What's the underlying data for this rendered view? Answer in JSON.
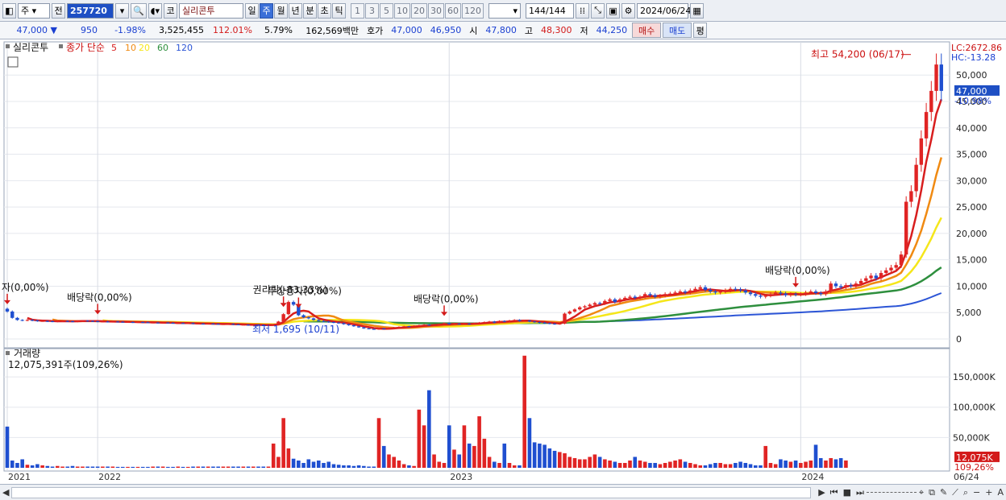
{
  "toolbar": {
    "market": "주",
    "prev": "전",
    "code": "257720",
    "name": "실리콘투",
    "periods": [
      "일",
      "주",
      "월",
      "년",
      "분",
      "초",
      "틱"
    ],
    "selected_period": "주",
    "nums": [
      "1",
      "3",
      "5",
      "10",
      "20",
      "30",
      "60",
      "120"
    ],
    "count": "144",
    "total": "/144",
    "date": "2024/06/24",
    "co": "코"
  },
  "quote": {
    "price": "47,000",
    "arrow": "▼",
    "change": "950",
    "pct": "-1.98%",
    "volume": "3,525,455",
    "vol_ratio": "112.01%",
    "turnover": "5.79%",
    "amount": "162,569백만",
    "bid_label": "호가",
    "bid": "47,000",
    "ask": "46,950",
    "open_label": "시",
    "open": "47,800",
    "high_label": "고",
    "high": "48,300",
    "low_label": "저",
    "low": "44,250",
    "buy": "매수",
    "sell": "매도",
    "eval": "평"
  },
  "legend": {
    "name": "실리콘투",
    "ma_label": "종가 단순",
    "ma": [
      "5",
      "10",
      "20",
      "60",
      "120"
    ]
  },
  "colors": {
    "ma5": "#d81e1e",
    "ma10": "#f08a12",
    "ma20": "#f5e61a",
    "ma60": "#2e8f3e",
    "ma120": "#2c55d6",
    "up": "#e02424",
    "down": "#1f4fd0"
  },
  "price_panel": {
    "lc": "LC:2672.86",
    "hc": "HC:-13.28",
    "current": "47,000",
    "current_pct": "-10.98%",
    "yticks": [
      "50,000",
      "45,000",
      "40,000",
      "35,000",
      "30,000",
      "25,000",
      "20,000",
      "15,000",
      "10,000",
      "5,000",
      "0"
    ],
    "ymax": 54000,
    "annotations": [
      {
        "text": "자(0,00%)",
        "idx": 0
      },
      {
        "text": "배당락(0,00%)",
        "idx": 18
      },
      {
        "text": "권리락(-83,33%)",
        "idx": 55
      },
      {
        "text": "무상증자(0,00%)",
        "idx": 58
      },
      {
        "text": "배당락(0,00%)",
        "idx": 87
      },
      {
        "text": "배당락(0,00%)",
        "idx": 157
      }
    ],
    "high_label": "최고 54,200 (06/17)",
    "low_label": "최저 1,695 (10/11)"
  },
  "volume_panel": {
    "title": "거래량",
    "value": "12,075,391주(109,26%)",
    "yticks": [
      "150,000K",
      "100,000K",
      "50,000K"
    ],
    "current": "12,075K",
    "current_pct": "109,26%",
    "vmax": 190000
  },
  "xaxis": {
    "labels": [
      "2021",
      "2022",
      "2023",
      "2024",
      "06/24"
    ]
  },
  "chart_data": {
    "type": "candlestick",
    "title": "실리콘투",
    "ylim": [
      0,
      54200
    ],
    "series_note": "weekly",
    "x_year_starts": {
      "2021": 0,
      "2022": 18,
      "2023": 88,
      "2024": 158
    },
    "closes": [
      5200,
      4000,
      3600,
      3500,
      3600,
      3500,
      3400,
      3400,
      3350,
      3300,
      3350,
      3400,
      3350,
      3300,
      3400,
      3450,
      3400,
      3350,
      3300,
      3300,
      3250,
      3300,
      3250,
      3200,
      3200,
      3150,
      3200,
      3150,
      3100,
      3100,
      3050,
      3100,
      3050,
      3000,
      3000,
      2950,
      3000,
      2900,
      2900,
      2850,
      2900,
      2850,
      2800,
      2800,
      2850,
      2750,
      2700,
      2700,
      2600,
      2700,
      2650,
      2600,
      2650,
      2700,
      3300,
      4700,
      7000,
      6500,
      4500,
      4100,
      3900,
      3600,
      3400,
      3300,
      3200,
      3100,
      3000,
      2800,
      2600,
      2400,
      2200,
      2000,
      1900,
      1800,
      2000,
      1900,
      2100,
      2200,
      2300,
      2400,
      2300,
      2500,
      2600,
      2700,
      2600,
      2700,
      2800,
      3000,
      2800,
      2900,
      2800,
      2900,
      2800,
      3000,
      3100,
      3200,
      3300,
      3100,
      3400,
      3300,
      3500,
      3600,
      3400,
      3500,
      3300,
      3200,
      3100,
      3000,
      2900,
      2800,
      2900,
      4800,
      5200,
      5600,
      6000,
      6200,
      6500,
      6800,
      6700,
      7200,
      7500,
      7000,
      7500,
      7800,
      8000,
      7800,
      8000,
      8500,
      8300,
      8000,
      8200,
      8500,
      8600,
      8800,
      9000,
      8800,
      9200,
      9500,
      9800,
      9300,
      9000,
      8800,
      9000,
      9200,
      9500,
      9400,
      9200,
      8800,
      8500,
      8200,
      8000,
      8200,
      8500,
      8800,
      8600,
      8300,
      8500,
      8400,
      8500,
      8800,
      9000,
      8700,
      8500,
      9000,
      10500,
      10000,
      9800,
      10200,
      10000,
      10500,
      11000,
      11500,
      12000,
      11500,
      12500,
      13000,
      13500,
      14000,
      16000,
      26000,
      28000,
      33000,
      38000,
      43000,
      47000,
      52000,
      47000
    ],
    "volumes_k": [
      68000,
      12000,
      8000,
      14000,
      5000,
      4000,
      6000,
      4000,
      3000,
      2000,
      3000,
      2000,
      2000,
      3000,
      2000,
      2000,
      2000,
      2000,
      2000,
      2000,
      2000,
      2000,
      1500,
      1500,
      1500,
      1500,
      1500,
      1500,
      1500,
      2000,
      2000,
      2000,
      1500,
      1500,
      2000,
      1500,
      1500,
      2000,
      2000,
      2000,
      2000,
      2000,
      2000,
      2000,
      2000,
      2000,
      2000,
      2000,
      2000,
      2000,
      2000,
      2000,
      2000,
      40000,
      18000,
      82000,
      32000,
      15000,
      12000,
      8000,
      14000,
      10000,
      12000,
      8000,
      10000,
      6000,
      5000,
      4000,
      4000,
      3000,
      4000,
      3000,
      2000,
      2000,
      82000,
      36000,
      22000,
      18000,
      12000,
      6000,
      4000,
      3000,
      96000,
      70000,
      128000,
      22000,
      10000,
      8000,
      70000,
      30000,
      22000,
      70000,
      40000,
      36000,
      85000,
      48000,
      18000,
      10000,
      8000,
      40000,
      8000,
      4000,
      4000,
      185000,
      82000,
      42000,
      40000,
      38000,
      32000,
      28000,
      26000,
      24000,
      18000,
      16000,
      14000,
      14000,
      18000,
      22000,
      18000,
      14000,
      12000,
      10000,
      8000,
      8000,
      12000,
      18000,
      12000,
      10000,
      8000,
      8000,
      6000,
      8000,
      10000,
      12000,
      14000,
      10000,
      8000,
      6000,
      4000,
      4000,
      6000,
      8000,
      8000,
      6000,
      6000,
      8000,
      10000,
      8000,
      6000,
      4000,
      4000,
      36000,
      8000,
      6000,
      14000,
      12000,
      10000,
      12000,
      8000,
      10000,
      12000,
      38000,
      16000,
      12000,
      16000,
      14000,
      16000,
      12075
    ]
  }
}
